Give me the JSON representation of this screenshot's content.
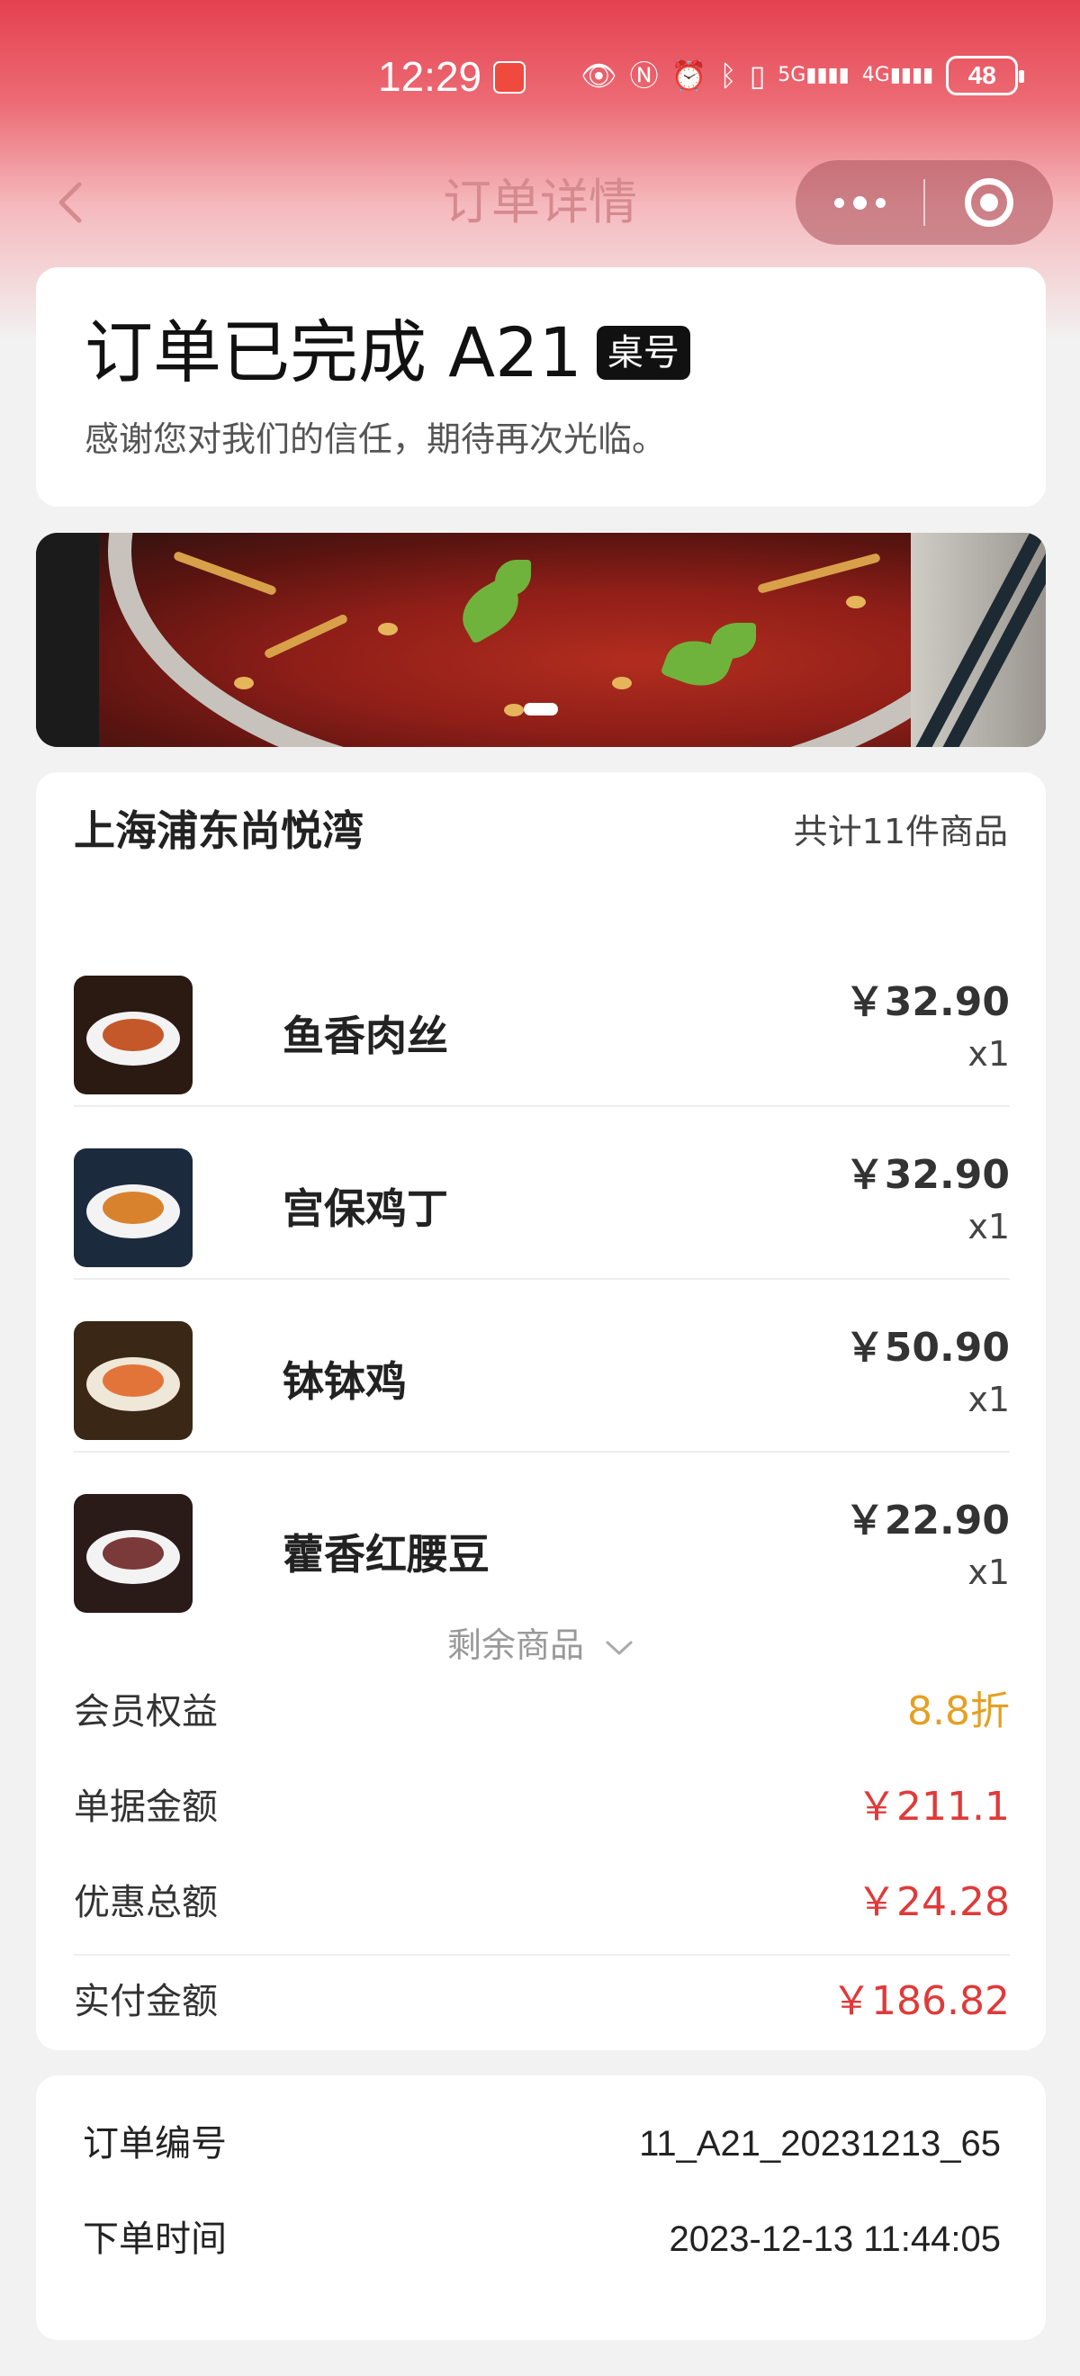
{
  "status_bar": {
    "time": "12:29",
    "icons": [
      "eye-icon",
      "nfc-icon",
      "alarm-icon",
      "bluetooth-icon",
      "vibrate-icon",
      "signal-5g-icon",
      "signal-4g-icon"
    ],
    "sig1_label": "5G",
    "sig2_label": "4G",
    "battery": "48"
  },
  "nav": {
    "title": "订单详情"
  },
  "order_status": {
    "title": "订单已完成 A21",
    "badge": "桌号",
    "subtitle": "感谢您对我们的信任，期待再次光临。"
  },
  "order": {
    "store_name": "上海浦东尚悦湾",
    "item_count": "共计11件商品",
    "items": [
      {
        "name": "鱼香肉丝",
        "price": "￥32.90",
        "qty": "x1",
        "colors": [
          "#2b1a12",
          "#c4582a"
        ]
      },
      {
        "name": "宫保鸡丁",
        "price": "￥32.90",
        "qty": "x1",
        "colors": [
          "#1c2a3e",
          "#d9822e"
        ]
      },
      {
        "name": "钵钵鸡",
        "price": "￥50.90",
        "qty": "x1",
        "colors": [
          "#3a2716",
          "#e2743a"
        ]
      },
      {
        "name": "藿香红腰豆",
        "price": "￥22.90",
        "qty": "x1",
        "colors": [
          "#2a1a18",
          "#7a3a3a"
        ]
      }
    ],
    "more_items": "剩余商品",
    "member_benefit": {
      "label": "会员权益",
      "value": "8.8折"
    },
    "bill_amount": {
      "label": "单据金额",
      "value": "￥211.1"
    },
    "discount_total": {
      "label": "优惠总额",
      "value": "￥24.28"
    },
    "paid_amount": {
      "label": "实付金额",
      "value": "￥186.82"
    }
  },
  "info": {
    "order_no": {
      "label": "订单编号",
      "value": "11_A21_20231213_65"
    },
    "order_time": {
      "label": "下单时间",
      "value": "2023-12-13 11:44:05"
    }
  },
  "colors": {
    "accent_red": "#e03a3a",
    "discount_orange": "#e5a023",
    "header_red": "#e54150"
  }
}
